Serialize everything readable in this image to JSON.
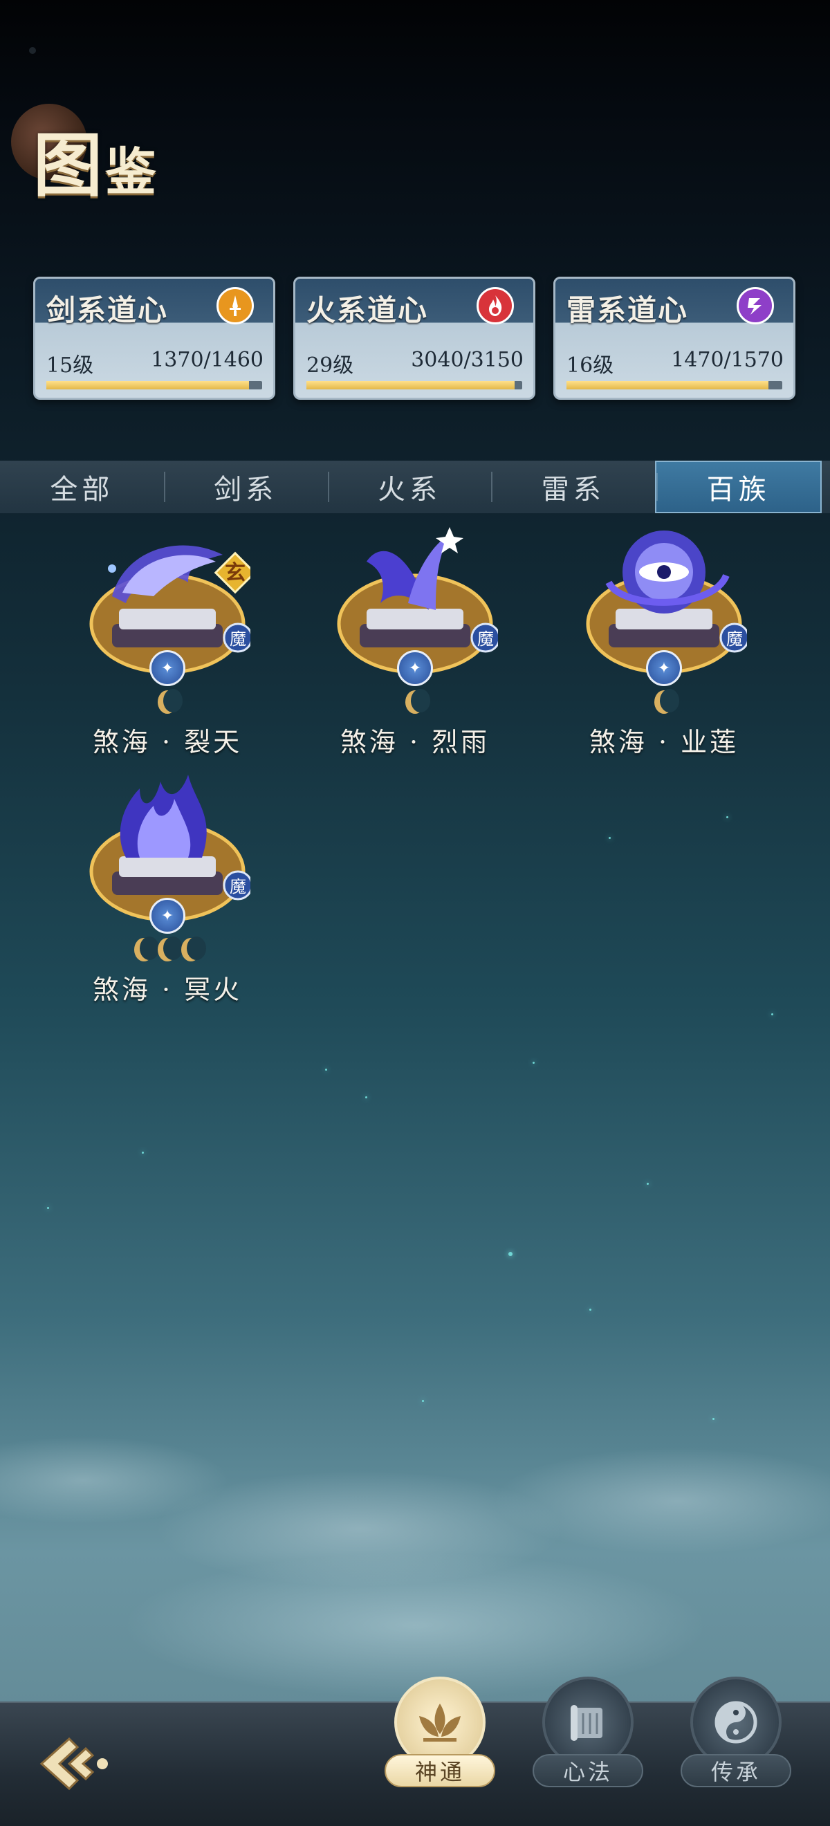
{
  "header": {
    "title_big": "图",
    "title_small": "鉴"
  },
  "dao_cards": [
    {
      "name": "剑系道心",
      "icon": "sword-icon",
      "color": "#e8961e",
      "level": "15级",
      "progress": "1370/1460",
      "fill": 0.938
    },
    {
      "name": "火系道心",
      "icon": "fire-icon",
      "color": "#d8333a",
      "level": "29级",
      "progress": "3040/3150",
      "fill": 0.965
    },
    {
      "name": "雷系道心",
      "icon": "thunder-icon",
      "color": "#8e3fc8",
      "level": "16级",
      "progress": "1470/1570",
      "fill": 0.936
    }
  ],
  "tabs": [
    {
      "label": "全部",
      "active": false
    },
    {
      "label": "剑系",
      "active": false
    },
    {
      "label": "火系",
      "active": false
    },
    {
      "label": "雷系",
      "active": false
    },
    {
      "label": "百族",
      "active": true
    }
  ],
  "items": [
    {
      "name": "煞海 · 裂天",
      "rank_badge": "玄",
      "tag": "魔",
      "stars": 1
    },
    {
      "name": "煞海 · 烈雨",
      "rank_badge": "",
      "tag": "魔",
      "stars": 1
    },
    {
      "name": "煞海 · 业莲",
      "rank_badge": "",
      "tag": "魔",
      "stars": 1
    },
    {
      "name": "煞海 · 冥火",
      "rank_badge": "",
      "tag": "魔",
      "stars": 3
    }
  ],
  "bottom_nav": [
    {
      "label": "神通",
      "icon": "lotus-icon",
      "active": true
    },
    {
      "label": "心法",
      "icon": "scroll-icon",
      "active": false
    },
    {
      "label": "传承",
      "icon": "yinyang-icon",
      "active": false
    }
  ]
}
